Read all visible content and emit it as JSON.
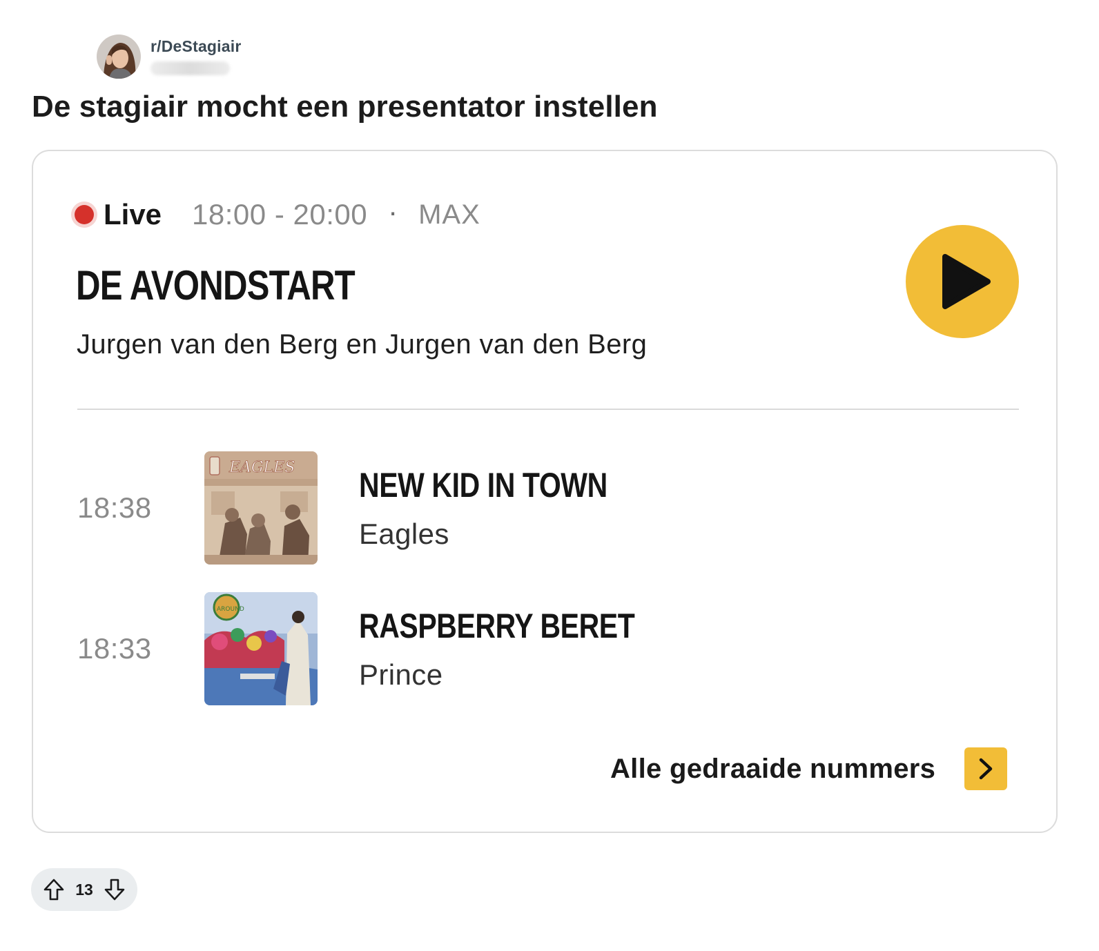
{
  "post": {
    "subreddit": "r/DeStagiair",
    "title": "De stagiair mocht een presentator instellen",
    "vote_count": "13"
  },
  "radio": {
    "live_label": "Live",
    "time_range": "18:00 - 20:00",
    "separator": "·",
    "channel": "MAX",
    "show_title": "DE AVONDSTART",
    "presenters": "Jurgen van den Berg en Jurgen van den Berg",
    "tracks": [
      {
        "time": "18:38",
        "title": "NEW KID IN TOWN",
        "artist": "Eagles"
      },
      {
        "time": "18:33",
        "title": "RASPBERRY BERET",
        "artist": "Prince"
      }
    ],
    "all_tracks_label": "Alle gedraaide nummers"
  },
  "icons": {
    "live": "live-dot-icon",
    "play": "play-icon",
    "chevron": "chevron-right-icon",
    "upvote": "upvote-arrow-icon",
    "downvote": "downvote-arrow-icon"
  },
  "colors": {
    "live_red": "#d5312b",
    "accent_yellow": "#f2bd37",
    "muted_gray": "#8a8a8a",
    "vote_pill_bg": "#eaedef"
  }
}
